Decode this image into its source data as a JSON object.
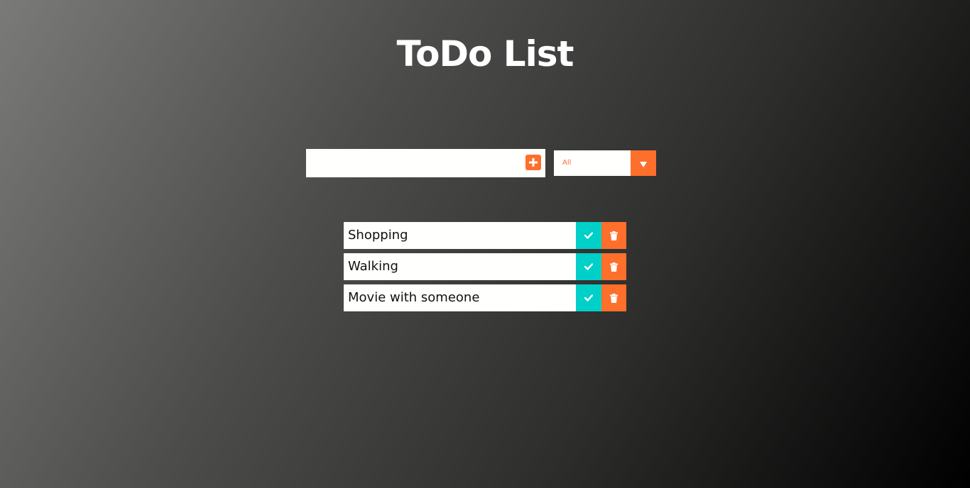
{
  "header": {
    "title": "ToDo List"
  },
  "form": {
    "input_value": "",
    "input_placeholder": "",
    "add_icon": "plus-square-icon"
  },
  "filter": {
    "selected": "All",
    "arrow_icon": "caret-down-icon"
  },
  "todos": [
    {
      "text": "Shopping",
      "complete_icon": "check-icon",
      "delete_icon": "trash-icon"
    },
    {
      "text": "Walking",
      "complete_icon": "check-icon",
      "delete_icon": "trash-icon"
    },
    {
      "text": "Movie with someone",
      "complete_icon": "check-icon",
      "delete_icon": "trash-icon"
    }
  ],
  "colors": {
    "accent": "#ff6f2c",
    "complete": "#00d0c8",
    "item_bg": "#fffffd"
  }
}
